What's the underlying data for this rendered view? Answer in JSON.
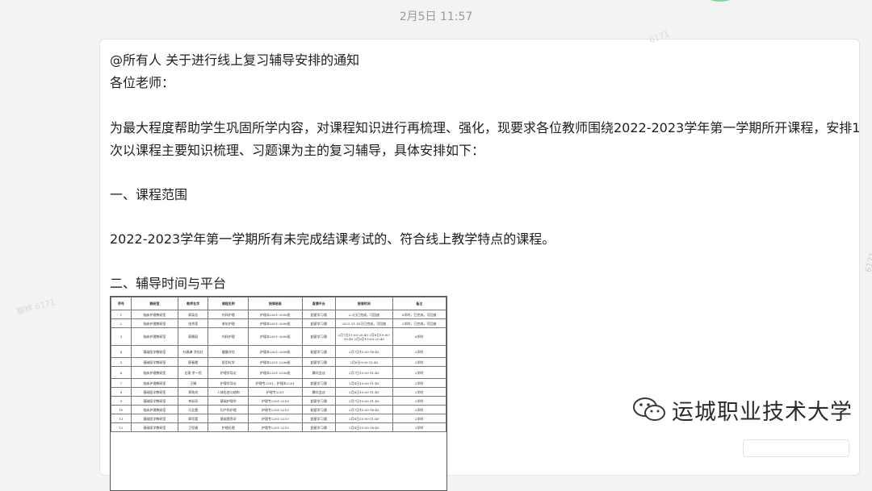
{
  "chat": {
    "timestamp": "2月5日 11:57",
    "message_lines": [
      "@所有人  关于进行线上复习辅导安排的通知",
      "各位老师：",
      "为最大程度帮助学生巩固所学内容，对课程知识进行再梳理、强化，现要求各位教师围绕2022-2023学年第一学期所开课程，安排1",
      "次以课程主要知识梳理、习题课为主的复习辅导，具体安排如下：",
      "一、课程范围",
      "2022-2023学年第一学期所有未完成结课考试的、符合线上教学特点的课程。",
      "二、辅导时间与平台"
    ]
  },
  "watermarks": {
    "bubble_top": "6171",
    "left": "聊梓 6171",
    "right": "6171"
  },
  "schedule_table": {
    "headers": [
      "序号",
      "教研室",
      "教师名字",
      "课程名称",
      "授课班级",
      "直播平台",
      "授课时间",
      "备注"
    ],
    "rows": [
      [
        "1",
        "临床护理教研室",
        "郭英佳",
        "外科护理",
        "护理本2001-2008班",
        "超星学习通",
        "2.3日已完成，可回放",
        "6学时，已完成，可回放"
      ],
      [
        "2",
        "临床护理教研室",
        "张秀莲",
        "老年护理",
        "护理本2001-2008班",
        "超星学习通",
        "2022.11.16日已完成，可回放",
        "2学时，已完成，可回放"
      ],
      [
        "3",
        "临床护理教研室",
        "郭晨丽",
        "内科护理",
        "护理本2001-2008班",
        "超星学习通",
        "2月7日19:00-20:40 2月8日19:00-20:40 2月9日19:00-20:40",
        "6学时"
      ],
      [
        "4",
        "基础医学教研室",
        "杜春琳 涂佳红",
        "健康评估",
        "护理本2001-2008班",
        "超星学习通",
        "2月7日15:00-16:40",
        "2学时"
      ],
      [
        "5",
        "基础医学教研室",
        "薛春霞",
        "医用化学",
        "护理本2201-2206班",
        "超星学习通",
        "2月6日9:00-11:40",
        "2学时"
      ],
      [
        "6",
        "临床护理教研室",
        "吕燕 余一恒",
        "护理学导论",
        "护理本2201-2206班",
        "腾讯会议",
        "2月7日10:00-11:40",
        "2学时"
      ],
      [
        "7",
        "临床护理教研室",
        "王娟",
        "护理学导论",
        "护理专2201、护理本2201",
        "超星学习通",
        "2月8日10:00-11:40",
        "2学时"
      ],
      [
        "8",
        "基础医学教研室",
        "郑秋尚",
        "人体形态与结构",
        "护理专2201",
        "腾讯会议",
        "2月6日10:00-11:40",
        "2学时"
      ],
      [
        "9",
        "基础医学教研室",
        "李彩凤",
        "基础护理学",
        "护理专2201-2210",
        "超星学习通",
        "2月7日10:00-11:40",
        "2学时"
      ],
      [
        "10",
        "临床护理教研室",
        "冯艾霞",
        "妇产科护理",
        "护理专2201-2210",
        "超星学习通",
        "2月7日15:00-16:40",
        "2学时"
      ],
      [
        "11",
        "基础医学教研室",
        "郭钰蓉",
        "基础营养学",
        "护理专2201-2210",
        "超星学习通",
        "2月8日10:00-11:40",
        "2学时"
      ],
      [
        "12",
        "基础医学教研室",
        "卫亚娟",
        "护理伦理",
        "护理专2201-2210",
        "超星学习通",
        "2月8日15:00-16:40",
        "2学时"
      ]
    ]
  },
  "brand": {
    "name": "运城职业技术大学"
  }
}
